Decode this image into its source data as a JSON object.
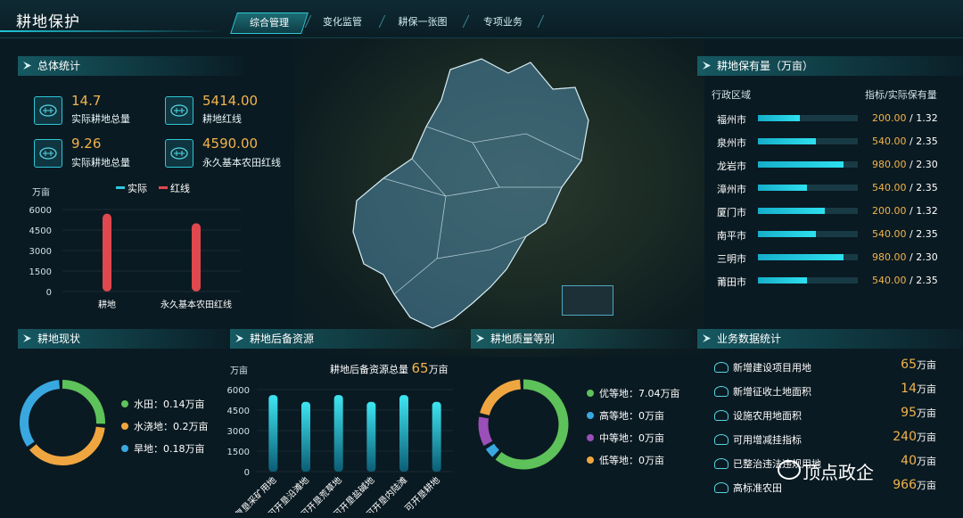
{
  "app": {
    "title": "耕地保护"
  },
  "nav": {
    "tabs": [
      "综合管理",
      "变化监管",
      "耕保一张图",
      "专项业务"
    ]
  },
  "overall": {
    "title": "总体统计",
    "stats": [
      {
        "value": "14.7",
        "label": "实际耕地总量"
      },
      {
        "value": "5414.00",
        "label": "耕地红线"
      },
      {
        "value": "9.26",
        "label": "实际耕地总量"
      },
      {
        "value": "4590.00",
        "label": "永久基本农田红线"
      }
    ]
  },
  "chart_data": [
    {
      "type": "bar",
      "unit": "万亩",
      "legend": [
        "实际",
        "红线"
      ],
      "categories": [
        "耕地",
        "永久基本农田红线"
      ],
      "series": [
        {
          "name": "实际",
          "values": [
            0,
            0
          ]
        },
        {
          "name": "红线",
          "values": [
            5700,
            5000
          ]
        }
      ],
      "yticks": [
        "6000",
        "4500",
        "3000",
        "1500",
        "0"
      ],
      "ylim": [
        0,
        6000
      ],
      "colors": {
        "actual": "#2ec7e0",
        "red": "#e0484f"
      }
    },
    {
      "type": "bar",
      "title": "耕地后备资源",
      "unit": "万亩",
      "total_label": "耕地后备资源总量",
      "total_value": "65",
      "total_unit": "万亩",
      "categories": [
        "可复垦采矿用地",
        "可开垦沿滩地",
        "可开垦荒草地",
        "可开垦盐碱地",
        "可开垦内陆滩",
        "可开垦耕地"
      ],
      "values": [
        5600,
        5100,
        5600,
        5100,
        5600,
        5100
      ],
      "yticks": [
        "6000",
        "4500",
        "3000",
        "1500",
        "0"
      ],
      "ylim": [
        0,
        6000
      ]
    },
    {
      "type": "pie",
      "title": "耕地现状",
      "slices": [
        {
          "label": "水田：0.14万亩",
          "value": 0.14,
          "color": "#5ec25a"
        },
        {
          "label": "水浇地：0.2万亩",
          "value": 0.2,
          "color": "#f0a640"
        },
        {
          "label": "旱地：0.18万亩",
          "value": 0.18,
          "color": "#39a8e0"
        }
      ]
    },
    {
      "type": "pie",
      "title": "耕地质量等别",
      "slices": [
        {
          "label": "优等地：7.04万亩",
          "value": 7.04,
          "color": "#5ec25a"
        },
        {
          "label": "高等地：0万亩",
          "value": 0,
          "color": "#39a8e0"
        },
        {
          "label": "中等地：0万亩",
          "value": 0,
          "color": "#9b4fb8"
        },
        {
          "label": "低等地：0万亩",
          "value": 0,
          "color": "#f0a640"
        }
      ]
    }
  ],
  "holdings": {
    "title": "耕地保有量（万亩）",
    "col_region": "行政区域",
    "col_value": "指标/实际保有量",
    "rows": [
      {
        "name": "福州市",
        "target": "200.00",
        "actual": "1.32",
        "fill": 0.42
      },
      {
        "name": "泉州市",
        "target": "540.00",
        "actual": "2.35",
        "fill": 0.58
      },
      {
        "name": "龙岩市",
        "target": "980.00",
        "actual": "2.30",
        "fill": 0.86
      },
      {
        "name": "漳州市",
        "target": "540.00",
        "actual": "2.35",
        "fill": 0.49
      },
      {
        "name": "厦门市",
        "target": "200.00",
        "actual": "1.32",
        "fill": 0.67
      },
      {
        "name": "南平市",
        "target": "540.00",
        "actual": "2.35",
        "fill": 0.58
      },
      {
        "name": "三明市",
        "target": "980.00",
        "actual": "2.30",
        "fill": 0.86
      },
      {
        "name": "莆田市",
        "target": "540.00",
        "actual": "2.35",
        "fill": 0.49
      }
    ]
  },
  "business": {
    "title": "业务数据统计",
    "items": [
      {
        "label": "新增建设项目用地",
        "value": "65",
        "unit": "万亩"
      },
      {
        "label": "新增征收土地面积",
        "value": "14",
        "unit": "万亩"
      },
      {
        "label": "设施农用地面积",
        "value": "95",
        "unit": "万亩"
      },
      {
        "label": "可用增减挂指标",
        "value": "240",
        "unit": "万亩"
      },
      {
        "label": "已整治违法违规用地",
        "value": "40",
        "unit": "万亩"
      },
      {
        "label": "高标准农田",
        "value": "966",
        "unit": "万亩"
      }
    ]
  },
  "watermark": "顶点政企",
  "colors": {
    "accent": "#2fc7d6",
    "value": "#f2b44c",
    "background": "#0a1a22"
  }
}
